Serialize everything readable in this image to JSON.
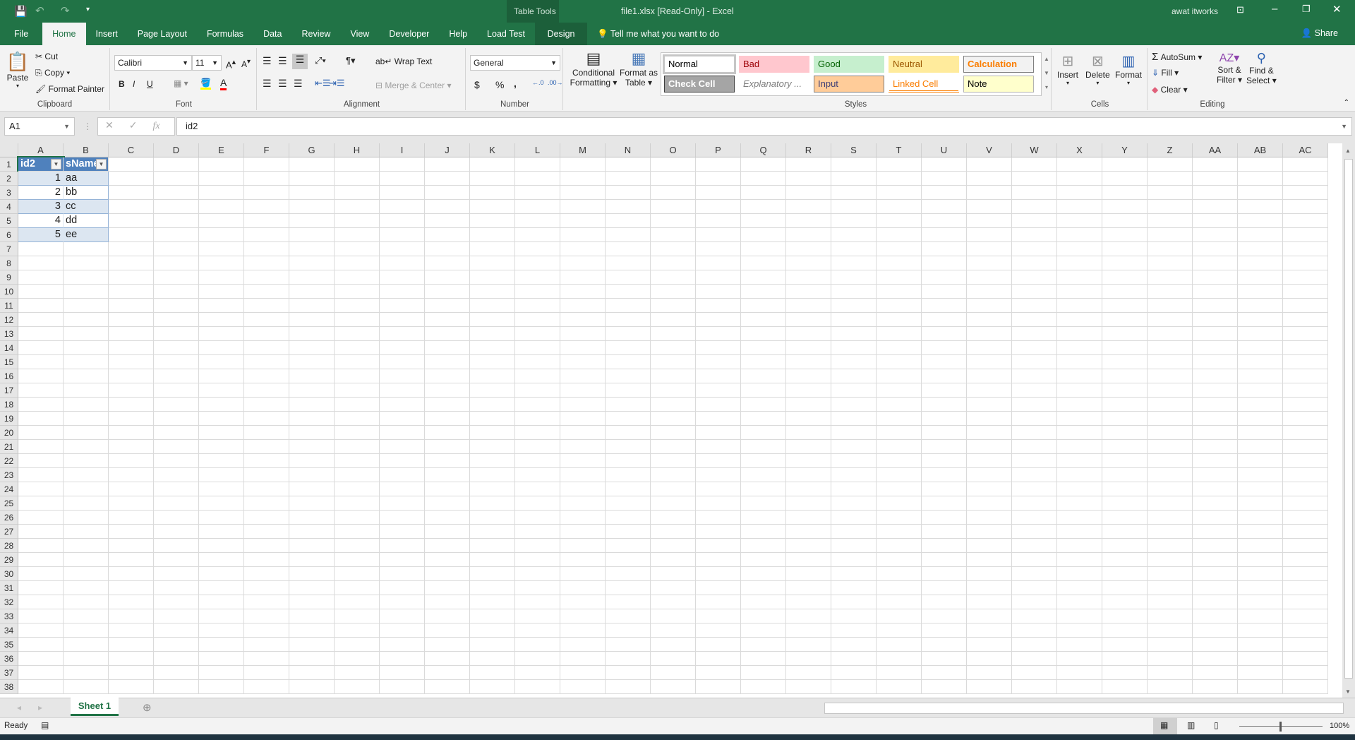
{
  "title": {
    "context": "Table Tools",
    "doc": "file1.xlsx  [Read-Only]  -  Excel",
    "user": "awat itworks"
  },
  "tabs": [
    "File",
    "Home",
    "Insert",
    "Page Layout",
    "Formulas",
    "Data",
    "Review",
    "View",
    "Developer",
    "Help",
    "Load Test",
    "Design"
  ],
  "tell_me": "Tell me what you want to do",
  "share": "Share",
  "clipboard": {
    "paste": "Paste",
    "cut": "Cut",
    "copy": "Copy",
    "format_painter": "Format Painter",
    "label": "Clipboard"
  },
  "font": {
    "name": "Calibri",
    "size": "11",
    "label": "Font",
    "bold": "B",
    "italic": "I",
    "underline": "U"
  },
  "alignment": {
    "wrap": "Wrap Text",
    "merge": "Merge & Center",
    "label": "Alignment"
  },
  "number": {
    "format": "General",
    "currency": "$",
    "percent": "%",
    "comma": ",",
    "label": "Number"
  },
  "conditional": {
    "l1": "Conditional",
    "l2": "Formatting"
  },
  "format_table": {
    "l1": "Format as",
    "l2": "Table"
  },
  "styles": {
    "label": "Styles",
    "items": [
      {
        "name": "Normal",
        "fg": "#000000",
        "bg": "#ffffff",
        "border": "#c6c6c6"
      },
      {
        "name": "Bad",
        "fg": "#9c0006",
        "bg": "#ffc7ce"
      },
      {
        "name": "Good",
        "fg": "#006100",
        "bg": "#c6efce"
      },
      {
        "name": "Neutral",
        "fg": "#9c5700",
        "bg": "#ffeb9c"
      },
      {
        "name": "Calculation",
        "fg": "#fa7d00",
        "bg": "#f2f2f2",
        "border": "#7f7f7f"
      },
      {
        "name": "Check Cell",
        "fg": "#ffffff",
        "bg": "#a5a5a5",
        "border": "#3f3f3f"
      },
      {
        "name": "Explanatory ...",
        "fg": "#7f7f7f",
        "bg": "#ffffff"
      },
      {
        "name": "Input",
        "fg": "#3f3f76",
        "bg": "#ffcc99",
        "border": "#7f7f7f"
      },
      {
        "name": "Linked Cell",
        "fg": "#fa7d00",
        "bg": "#ffffff"
      },
      {
        "name": "Note",
        "fg": "#000000",
        "bg": "#ffffcc",
        "border": "#b2b2b2"
      }
    ]
  },
  "cells_group": {
    "insert": "Insert",
    "delete": "Delete",
    "format": "Format",
    "label": "Cells"
  },
  "editing": {
    "autosum": "AutoSum",
    "fill": "Fill",
    "clear": "Clear",
    "sort1": "Sort &",
    "sort2": "Filter",
    "find1": "Find &",
    "find2": "Select",
    "label": "Editing"
  },
  "name_box": "A1",
  "formula": "id2",
  "columns": [
    "A",
    "B",
    "C",
    "D",
    "E",
    "F",
    "G",
    "H",
    "I",
    "J",
    "K",
    "L",
    "M",
    "N",
    "O",
    "P",
    "Q",
    "R",
    "S",
    "T",
    "U",
    "V",
    "W",
    "X",
    "Y",
    "Z",
    "AA",
    "AB",
    "AC"
  ],
  "rows": [
    "1",
    "2",
    "3",
    "4",
    "5",
    "6",
    "7",
    "8",
    "9",
    "10",
    "11",
    "12",
    "13",
    "14",
    "15",
    "16",
    "17",
    "18",
    "19",
    "20",
    "21",
    "22",
    "23",
    "24",
    "25",
    "26",
    "27",
    "28",
    "29",
    "30",
    "31",
    "32",
    "33",
    "34",
    "35",
    "36",
    "37",
    "38"
  ],
  "table": {
    "headers": [
      "id2",
      "sName"
    ],
    "rows": [
      [
        "1",
        "aa"
      ],
      [
        "2",
        "bb"
      ],
      [
        "3",
        "cc"
      ],
      [
        "4",
        "dd"
      ],
      [
        "5",
        "ee"
      ]
    ],
    "header_color": "#4f81bd",
    "band_color": "#dce6f1"
  },
  "sheet_tab": "Sheet 1",
  "status": {
    "ready": "Ready",
    "zoom": "100%"
  }
}
